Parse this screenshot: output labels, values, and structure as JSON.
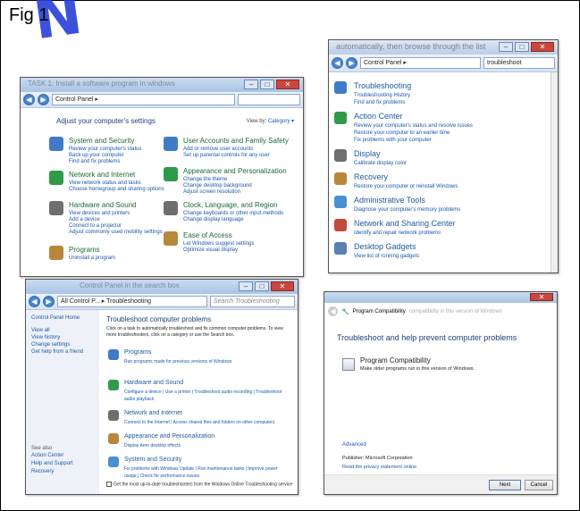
{
  "figure": {
    "label": "Fig 1",
    "watermark": "N"
  },
  "shot1": {
    "title": "TASK 1: Install a software program in windows",
    "address": "Control Panel ▸",
    "heading": "Adjust your computer's settings",
    "view_by": "View by:",
    "view_by_value": "Category ▾",
    "left_categories": [
      {
        "title": "System and Security",
        "links": [
          "Review your computer's status",
          "Back up your computer",
          "Find and fix problems"
        ]
      },
      {
        "title": "Network and Internet",
        "links": [
          "View network status and tasks",
          "Choose homegroup and sharing options"
        ]
      },
      {
        "title": "Hardware and Sound",
        "links": [
          "View devices and printers",
          "Add a device",
          "Connect to a projector",
          "Adjust commonly used mobility settings"
        ]
      },
      {
        "title": "Programs",
        "links": [
          "Uninstall a program"
        ]
      }
    ],
    "right_categories": [
      {
        "title": "User Accounts and Family Safety",
        "links": [
          "Add or remove user accounts",
          "Set up parental controls for any user"
        ]
      },
      {
        "title": "Appearance and Personalization",
        "links": [
          "Change the theme",
          "Change desktop background",
          "Adjust screen resolution"
        ]
      },
      {
        "title": "Clock, Language, and Region",
        "links": [
          "Change keyboards or other input methods",
          "Change display language"
        ]
      },
      {
        "title": "Ease of Access",
        "links": [
          "Let Windows suggest settings",
          "Optimize visual display"
        ]
      }
    ]
  },
  "shot2": {
    "caption_behind": "automatically, then browse through the list",
    "address": "Control Panel ▸",
    "search_value": "troubleshoot",
    "results": [
      {
        "title": "Troubleshooting",
        "links": [
          "Troubleshooting History",
          "Find and fix problems"
        ]
      },
      {
        "title": "Action Center",
        "links": [
          "Review your computer's status and resolve issues",
          "Restore your computer to an earlier time",
          "Fix problems with your computer"
        ]
      },
      {
        "title": "Display",
        "links": [
          "Calibrate display color"
        ]
      },
      {
        "title": "Recovery",
        "links": [
          "Restore your computer or reinstall Windows"
        ]
      },
      {
        "title": "Administrative Tools",
        "links": [
          "Diagnose your computer's memory problems"
        ]
      },
      {
        "title": "Network and Sharing Center",
        "links": [
          "Identify and repair network problems"
        ]
      },
      {
        "title": "Desktop Gadgets",
        "links": [
          "View list of running gadgets"
        ]
      }
    ]
  },
  "shot3": {
    "caption_behind": "Control Panel   in the search box",
    "address": "All Control P... ▸ Troubleshooting",
    "search_placeholder": "Search Troubleshooting",
    "sidebar": [
      "Control Panel Home",
      "View all",
      "View history",
      "Change settings",
      "Get help from a friend"
    ],
    "see_also_label": "See also",
    "see_also": [
      "Action Center",
      "Help and Support",
      "Recovery"
    ],
    "title": "Troubleshoot computer problems",
    "description": "Click on a task to automatically troubleshoot and fix common computer problems. To view more troubleshooters, click on a category or use the Search box.",
    "sections": [
      {
        "title": "Programs",
        "links": "Run programs made for previous versions of Windows"
      },
      {
        "title": "Hardware and Sound",
        "links": "Configure a device  |  Use a printer  |  Troubleshoot audio recording  |  Troubleshoot audio playback"
      },
      {
        "title": "Network and Internet",
        "links": "Connect to the Internet  |  Access shared files and folders on other computers"
      },
      {
        "title": "Appearance and Personalization",
        "links": "Display Aero desktop effects"
      },
      {
        "title": "System and Security",
        "links": "Fix problems with Windows Update  |  Run maintenance tasks  |  Improve power usage  |  Check for performance issues"
      }
    ],
    "checkbox_label": "Get the most up-to-date troubleshooters from the Windows Online Troubleshooting service"
  },
  "shot4": {
    "caption_behind": "compatibility in this version of Windows",
    "title": "Program Compatibility",
    "heading": "Troubleshoot and help prevent computer problems",
    "item_title": "Program Compatibility",
    "item_desc": "Make older programs run in this version of Windows.",
    "advanced": "Advanced",
    "publisher_label": "Publisher:",
    "publisher": "Microsoft Corporation",
    "privacy": "Read the privacy statement online",
    "next": "Next",
    "cancel": "Cancel"
  },
  "colors": {
    "link": "#1a56b0",
    "heading": "#1d6a2f",
    "titlebar": "#a9c4e6",
    "close": "#c9473d"
  }
}
